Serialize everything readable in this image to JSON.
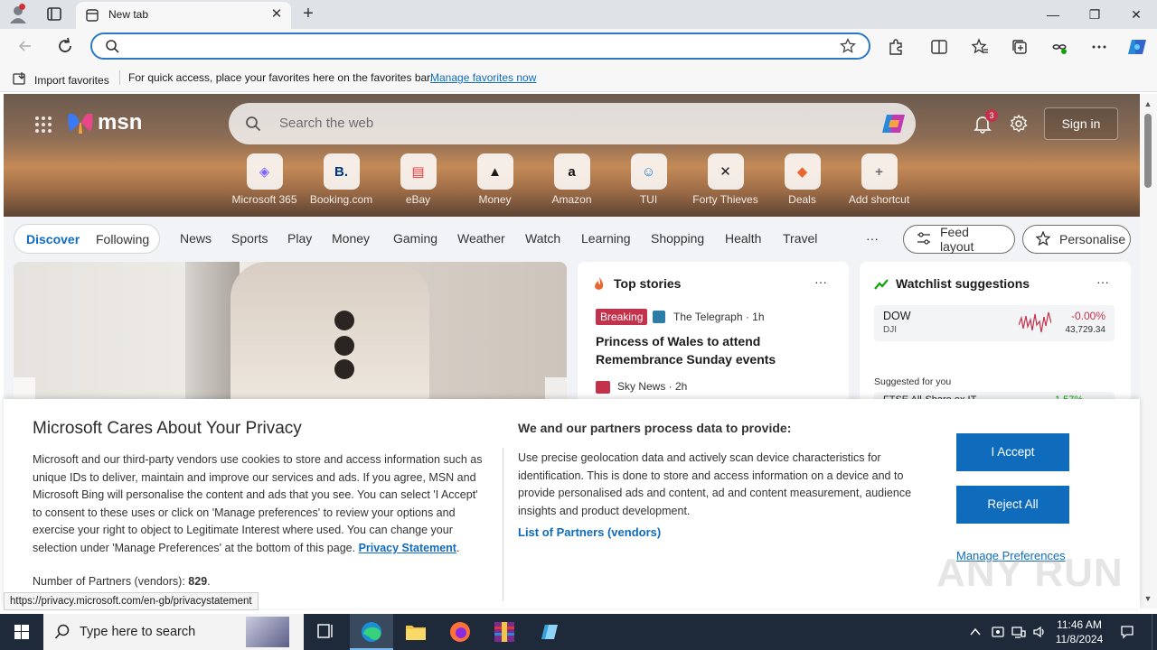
{
  "browser": {
    "tab_title": "New tab",
    "address_placeholder": "",
    "favbar": {
      "import_label": "Import favorites",
      "hint": "For quick access, place your favorites here on the favorites bar.",
      "manage_link": "Manage favorites now"
    }
  },
  "msn": {
    "logo_text": "msn",
    "search_placeholder": "Search the web",
    "notification_count": "3",
    "signin_label": "Sign in",
    "shortcuts": [
      {
        "label": "Microsoft 365",
        "glyph": "◈",
        "color": "#7b61ff"
      },
      {
        "label": "Booking.com",
        "glyph": "B.",
        "color": "#003580"
      },
      {
        "label": "eBay",
        "glyph": "▤",
        "color": "#e53238"
      },
      {
        "label": "Money",
        "glyph": "▲",
        "color": "#1a1a1a"
      },
      {
        "label": "Amazon",
        "glyph": "a",
        "color": "#111111"
      },
      {
        "label": "TUI",
        "glyph": "☺",
        "color": "#1f7fd2"
      },
      {
        "label": "Forty Thieves",
        "glyph": "✕",
        "color": "#222222"
      },
      {
        "label": "Deals",
        "glyph": "◆",
        "color": "#e8672e"
      },
      {
        "label": "Add shortcut",
        "glyph": "+",
        "color": "#6d6d6d"
      }
    ],
    "nav": {
      "discover": "Discover",
      "following": "Following",
      "links": [
        "News",
        "Sports",
        "Play",
        "Money",
        "Gaming",
        "Weather",
        "Watch",
        "Learning",
        "Shopping",
        "Health",
        "Travel"
      ],
      "more": "···",
      "feed_layout": "Feed layout",
      "personalise": "Personalise"
    },
    "top_stories": {
      "title": "Top stories",
      "more": "···",
      "breaking": "Breaking",
      "source1": "The Telegraph · 1h",
      "headline1": "Princess of Wales to attend Remembrance Sunday events",
      "source2": "Sky News · 2h"
    },
    "watchlist": {
      "title": "Watchlist suggestions",
      "more": "···",
      "ticker": "DOW",
      "exchange": "DJI",
      "change": "-0.00%",
      "price": "43,729.34",
      "suggested": "Suggested for you",
      "partial_ticker": "FTSE All-Share ex IT",
      "partial_change": "1.57%"
    }
  },
  "privacy": {
    "title": "Microsoft Cares About Your Privacy",
    "body_before_link": "Microsoft and our third-party vendors use cookies to store and access information such as unique IDs to deliver, maintain and improve our services and ads. If you agree, MSN and Microsoft Bing will personalise the content and ads that you see. You can select 'I Accept' to consent to these uses or click on 'Manage preferences' to review your options and exercise your right to object to Legitimate Interest where used.  You can change your selection under 'Manage Preferences' at the bottom of this page.",
    "privacy_link": "Privacy Statement",
    "partners_label": "Number of Partners (vendors):",
    "partners_count": "829",
    "right_title": "We and our partners process data to provide:",
    "right_body": "Use precise geolocation data and actively scan device characteristics for identification. This is done to store and access information on a device and to provide personalised ads and content, ad and content measurement, audience insights and product development.",
    "vendors_link": "List of Partners (vendors)",
    "accept": "I Accept",
    "reject": "Reject All",
    "manage": "Manage Preferences",
    "status_url": "https://privacy.microsoft.com/en-gb/privacystatement"
  },
  "watermark": "ANY RUN",
  "taskbar": {
    "search_placeholder": "Type here to search",
    "time": "11:46 AM",
    "date": "11/8/2024"
  },
  "colors": {
    "accent": "#0f6cbd",
    "taskbar": "#1e2a3a",
    "breaking": "#c4314b"
  }
}
